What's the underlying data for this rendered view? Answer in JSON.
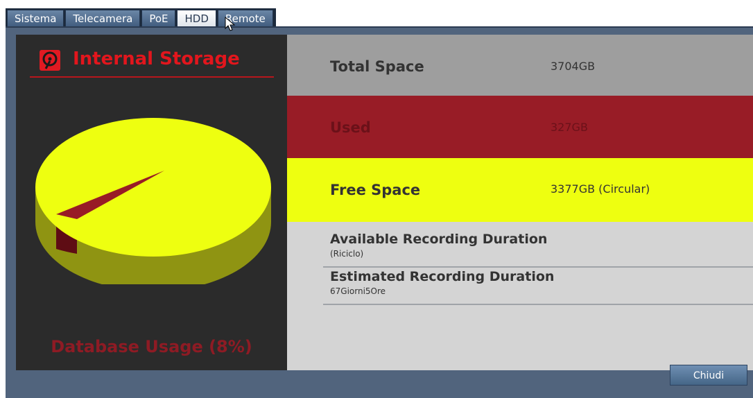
{
  "tabs": [
    {
      "label": "Sistema",
      "active": false
    },
    {
      "label": "Telecamera",
      "active": false
    },
    {
      "label": "PoE",
      "active": false
    },
    {
      "label": "HDD",
      "active": true
    },
    {
      "label": "Remote",
      "active": false
    }
  ],
  "left_panel": {
    "title": "Internal Storage",
    "icon": "hdd-icon",
    "db_usage": "Database Usage (8%)",
    "pie": {
      "used_percent": 8,
      "used_color": "#981c26",
      "free_color": "#eeff10"
    }
  },
  "storage": {
    "total": {
      "label": "Total Space",
      "value": "3704GB"
    },
    "used": {
      "label": "Used",
      "value": "327GB"
    },
    "free": {
      "label": "Free Space",
      "value": "3377GB (Circular)"
    }
  },
  "recording": {
    "available": {
      "label": "Available Recording Duration",
      "value": "(Riciclo)"
    },
    "estimated": {
      "label": "Estimated Recording Duration",
      "value": "67Giorni5Ore"
    }
  },
  "footer": {
    "close_label": "Chiudi"
  },
  "colors": {
    "accent_red": "#e2161d",
    "used": "#981c26",
    "free": "#eeff10",
    "window": "#51647d"
  }
}
